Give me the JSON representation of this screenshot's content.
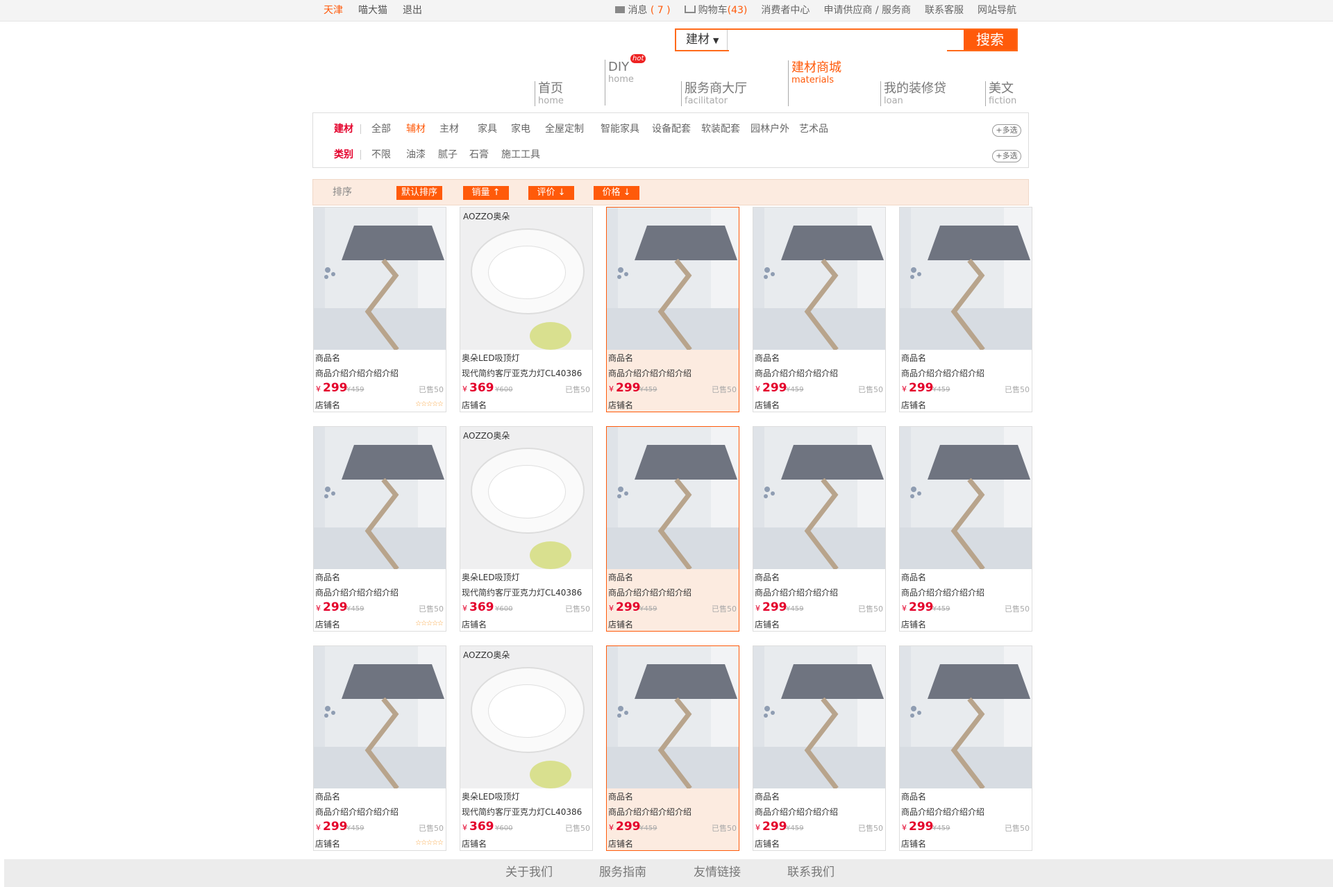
{
  "topbar": {
    "city": "天津",
    "brand": "喵大猫",
    "logout": "退出",
    "messages_label": "消息",
    "messages_count": "( 7 )",
    "cart_label": "购物车",
    "cart_count": "(43)",
    "consumer_center": "消费者中心",
    "apply": "申请供应商 / 服务商",
    "contact_service": "联系客服",
    "site_nav": "网站导航"
  },
  "search": {
    "category": "建材",
    "value": "",
    "button": "搜索"
  },
  "nav": [
    {
      "cn": "首页",
      "en": "home"
    },
    {
      "cn": "DIY",
      "en": "home",
      "badge": "hot"
    },
    {
      "cn": "服务商大厅",
      "en": "facilitator"
    },
    {
      "cn": "建材商城",
      "en": "materials",
      "active": true
    },
    {
      "cn": "我的装修贷",
      "en": "loan"
    },
    {
      "cn": "美文",
      "en": "fiction"
    }
  ],
  "filters": {
    "row1": {
      "label": "建材",
      "options": [
        "全部",
        "辅材",
        "主材",
        "家具",
        "家电",
        "全屋定制",
        "智能家具",
        "设备配套",
        "软装配套",
        "园林户外",
        "艺术品"
      ],
      "selected": "辅材",
      "more": "+多选"
    },
    "row2": {
      "label": "类别",
      "options": [
        "不限",
        "油漆",
        "腻子",
        "石膏",
        "施工工具"
      ],
      "more": "+多选"
    }
  },
  "sort": {
    "label": "排序",
    "buttons": [
      "默认排序",
      "销量",
      "评价",
      "价格"
    ]
  },
  "products": {
    "lamp": {
      "name": "商品名",
      "desc": "商品介绍介绍介绍介绍",
      "currency": "¥",
      "price": "299",
      "orig": "¥459",
      "sold": "已售50",
      "shop": "店铺名",
      "rating_stars": "☆☆☆☆☆"
    },
    "ceiling": {
      "brand_text": "AOZZO奥朵",
      "name": "奥朵LED吸顶灯",
      "desc": "现代简约客厅亚克力灯CL40386",
      "currency": "¥",
      "price": "369",
      "orig": "¥600",
      "sold": "已售50",
      "shop": "店铺名"
    }
  },
  "footer": {
    "links": [
      "关于我们",
      "服务指南",
      "友情链接",
      "联系我们"
    ]
  },
  "colors": {
    "accent": "#ff5a0a",
    "price": "#e4002b",
    "highlight_bg": "#fcebe0"
  }
}
